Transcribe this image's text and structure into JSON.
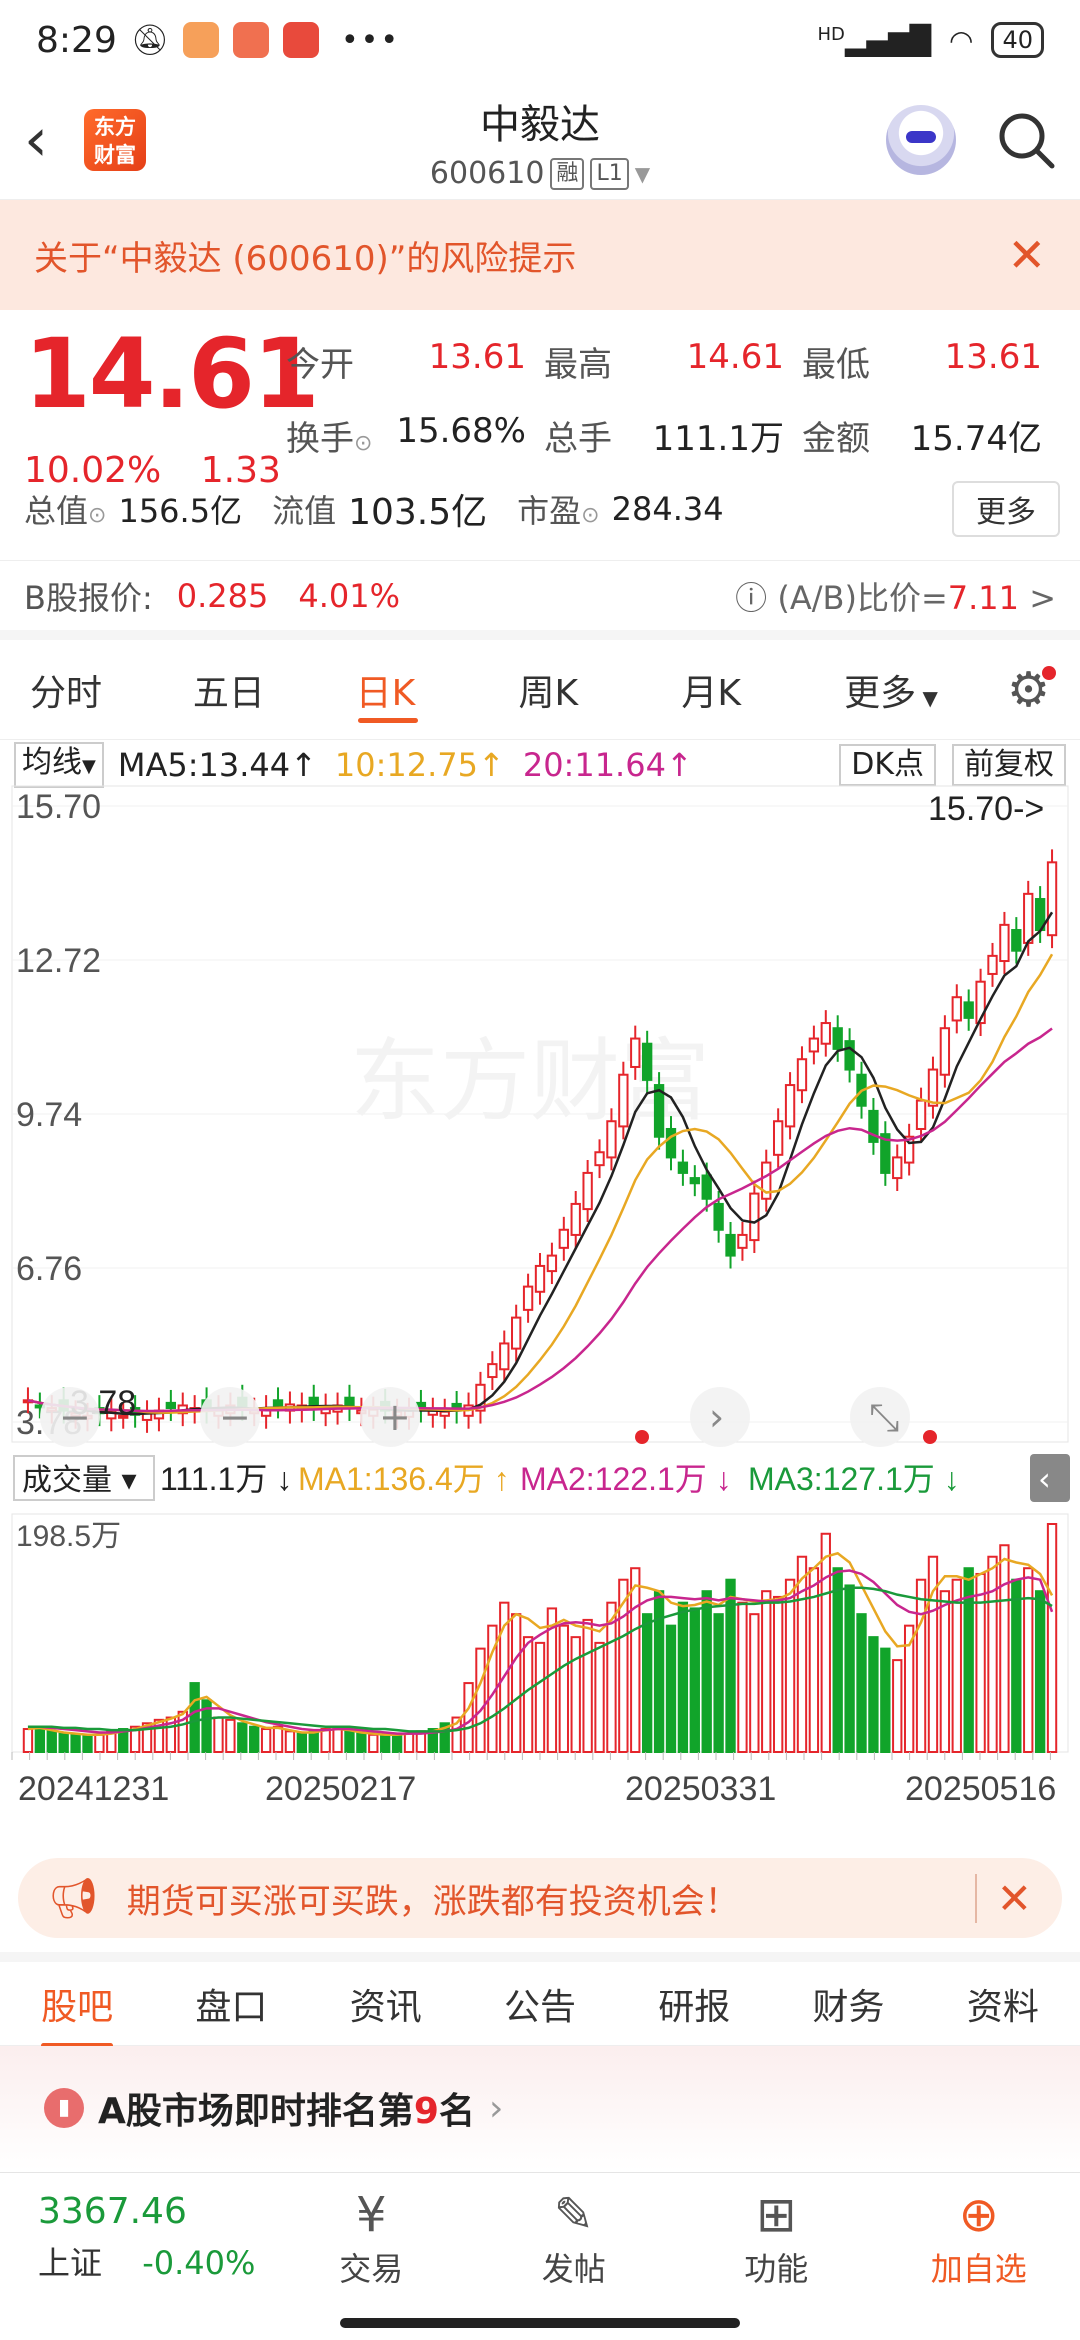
{
  "status": {
    "time": "8:29",
    "network": "HD",
    "battery": "40"
  },
  "header": {
    "logo_text": "东方财富",
    "stock_name": "中毅达",
    "stock_code": "600610",
    "tag1": "融",
    "tag2": "L1"
  },
  "risk_banner": {
    "text": "关于“中毅达 (600610)”的风险提示"
  },
  "quote": {
    "price": "14.61",
    "change_pct": "10.02%",
    "change_amt": "1.33",
    "open_label": "今开",
    "open": "13.61",
    "high_label": "最高",
    "high": "14.61",
    "low_label": "最低",
    "low": "13.61",
    "turnover_label": "换手",
    "turnover": "15.68%",
    "volume_label": "总手",
    "volume": "111.1万",
    "amount_label": "金额",
    "amount": "15.74亿",
    "mktcap_label": "总值",
    "mktcap": "156.5亿",
    "float_label": "流值",
    "float": "103.5亿",
    "pe_label": "市盈",
    "pe": "284.34",
    "more": "更多"
  },
  "bshare": {
    "label": "B股报价:",
    "price": "0.285",
    "pct": "4.01%",
    "ratio_label": "(A/B)比价=",
    "ratio": "7.11",
    "arrow": ">"
  },
  "period_tabs": [
    "分时",
    "五日",
    "日K",
    "周K",
    "月K",
    "更多"
  ],
  "active_period": 2,
  "ma_bar": {
    "selector": "均线",
    "ma5": "MA5:13.44",
    "ma10": "10:12.75",
    "ma20": "20:11.64",
    "dk": "DK点",
    "fq": "前复权"
  },
  "vol_bar": {
    "selector": "成交量",
    "vol": "111.1万",
    "ma1": "MA1:136.4万",
    "ma2": "MA2:122.1万",
    "ma3": "MA3:127.1万"
  },
  "colors": {
    "up": "#e5252b",
    "down": "#11a42a",
    "ma5": "#222222",
    "ma10": "#e8a823",
    "ma20": "#c8268e",
    "accent": "#f05a24"
  },
  "chart_data": {
    "type": "candlestick",
    "y_ticks": [
      "15.70",
      "12.72",
      "9.74",
      "6.76",
      "3.78"
    ],
    "ylim": [
      3.78,
      15.7
    ],
    "max_label": "15.70->",
    "min_label": "3.78",
    "vol_max_label": "198.5万",
    "x_labels": [
      "20241231",
      "20250217",
      "20250331",
      "20250516"
    ],
    "closes": [
      4.2,
      4.1,
      4.05,
      4.0,
      3.95,
      3.9,
      3.95,
      4.0,
      3.9,
      3.92,
      3.95,
      4.0,
      4.05,
      4.1,
      4.05,
      4.0,
      4.05,
      4.1,
      4.05,
      4.0,
      4.05,
      4.1,
      4.12,
      4.1,
      4.05,
      4.08,
      4.1,
      4.05,
      4.0,
      4.02,
      4.0,
      3.98,
      4.0,
      4.02,
      4.0,
      3.98,
      4.0,
      4.1,
      4.5,
      4.9,
      5.3,
      5.8,
      6.4,
      6.8,
      7.0,
      7.5,
      8.0,
      8.6,
      9.0,
      9.6,
      10.5,
      11.2,
      10.4,
      9.3,
      8.9,
      8.6,
      8.4,
      8.1,
      7.5,
      7.0,
      7.4,
      8.2,
      8.8,
      9.6,
      10.3,
      10.8,
      11.2,
      11.5,
      11.0,
      10.6,
      9.9,
      9.2,
      8.6,
      8.9,
      9.3,
      10.0,
      10.6,
      11.4,
      12.0,
      11.6,
      12.3,
      12.8,
      13.4,
      12.9,
      14.0,
      13.3,
      14.61
    ],
    "volumes": [
      20,
      22,
      18,
      16,
      15,
      14,
      15,
      18,
      20,
      22,
      25,
      28,
      30,
      35,
      60,
      45,
      30,
      28,
      25,
      22,
      20,
      22,
      18,
      16,
      18,
      20,
      22,
      18,
      16,
      15,
      14,
      15,
      16,
      18,
      20,
      25,
      30,
      60,
      90,
      110,
      130,
      120,
      100,
      95,
      125,
      110,
      100,
      115,
      95,
      130,
      150,
      160,
      120,
      140,
      110,
      130,
      125,
      140,
      120,
      150,
      130,
      120,
      140,
      135,
      150,
      170,
      160,
      190,
      160,
      145,
      120,
      100,
      90,
      80,
      110,
      150,
      170,
      140,
      150,
      160,
      155,
      170,
      180,
      150,
      160,
      140,
      198.5
    ],
    "vol_ma1": [
      20,
      21,
      19,
      17,
      16,
      15,
      15,
      16,
      18,
      20,
      23,
      26,
      29,
      33,
      45,
      48,
      40,
      32,
      27,
      24,
      21,
      21,
      19,
      17,
      17,
      19,
      20,
      19,
      17,
      16,
      15,
      15,
      16,
      17,
      18,
      21,
      25,
      38,
      60,
      87,
      110,
      120,
      116,
      108,
      110,
      115,
      110,
      108,
      105,
      115,
      130,
      145,
      143,
      140,
      130,
      127,
      128,
      131,
      128,
      135,
      133,
      131,
      132,
      133,
      138,
      151,
      160,
      170,
      173,
      165,
      145,
      125,
      105,
      92,
      93,
      113,
      140,
      153,
      153,
      150,
      155,
      160,
      168,
      165,
      163,
      155,
      136.4
    ],
    "vol_ma2": [
      22,
      22,
      21,
      20,
      19,
      18,
      17,
      17,
      18,
      19,
      21,
      23,
      25,
      28,
      35,
      38,
      38,
      35,
      32,
      29,
      26,
      24,
      22,
      20,
      19,
      19,
      20,
      20,
      19,
      18,
      17,
      16,
      16,
      16,
      17,
      18,
      20,
      26,
      36,
      50,
      66,
      82,
      95,
      102,
      108,
      112,
      113,
      112,
      110,
      112,
      118,
      126,
      132,
      135,
      135,
      134,
      133,
      134,
      132,
      134,
      133,
      132,
      131,
      132,
      134,
      140,
      145,
      152,
      157,
      158,
      155,
      148,
      138,
      128,
      122,
      120,
      123,
      128,
      132,
      135,
      137,
      140,
      146,
      150,
      152,
      150,
      122.1
    ],
    "vol_ma3": [
      22,
      22,
      22,
      21,
      21,
      20,
      20,
      19,
      19,
      19,
      20,
      21,
      22,
      24,
      27,
      29,
      30,
      30,
      29,
      28,
      27,
      26,
      25,
      24,
      23,
      22,
      22,
      22,
      21,
      20,
      20,
      19,
      18,
      18,
      18,
      18,
      19,
      21,
      25,
      31,
      38,
      46,
      54,
      61,
      68,
      75,
      81,
      86,
      91,
      96,
      101,
      107,
      112,
      116,
      119,
      122,
      124,
      126,
      127,
      128,
      129,
      129,
      130,
      130,
      131,
      133,
      135,
      138,
      141,
      143,
      143,
      142,
      140,
      137,
      135,
      133,
      132,
      131,
      130,
      130,
      130,
      131,
      132,
      133,
      134,
      133,
      127.1
    ]
  },
  "promo": {
    "text": "期货可买涨可买跌，涨跌都有投资机会！"
  },
  "sub_tabs": [
    "股吧",
    "盘口",
    "资讯",
    "公告",
    "研报",
    "财务",
    "资料"
  ],
  "rank": {
    "pre": "A股市场即时排名第",
    "num": "9",
    "post": "名"
  },
  "bottom": {
    "index_val": "3367.46",
    "index_name": "上证",
    "index_pct": "-0.40%",
    "nav": [
      {
        "label": "交易",
        "icon": "¥"
      },
      {
        "label": "发帖",
        "icon": "✎"
      },
      {
        "label": "功能",
        "icon": "⊞"
      },
      {
        "label": "加自选",
        "icon": "⊕"
      }
    ]
  }
}
